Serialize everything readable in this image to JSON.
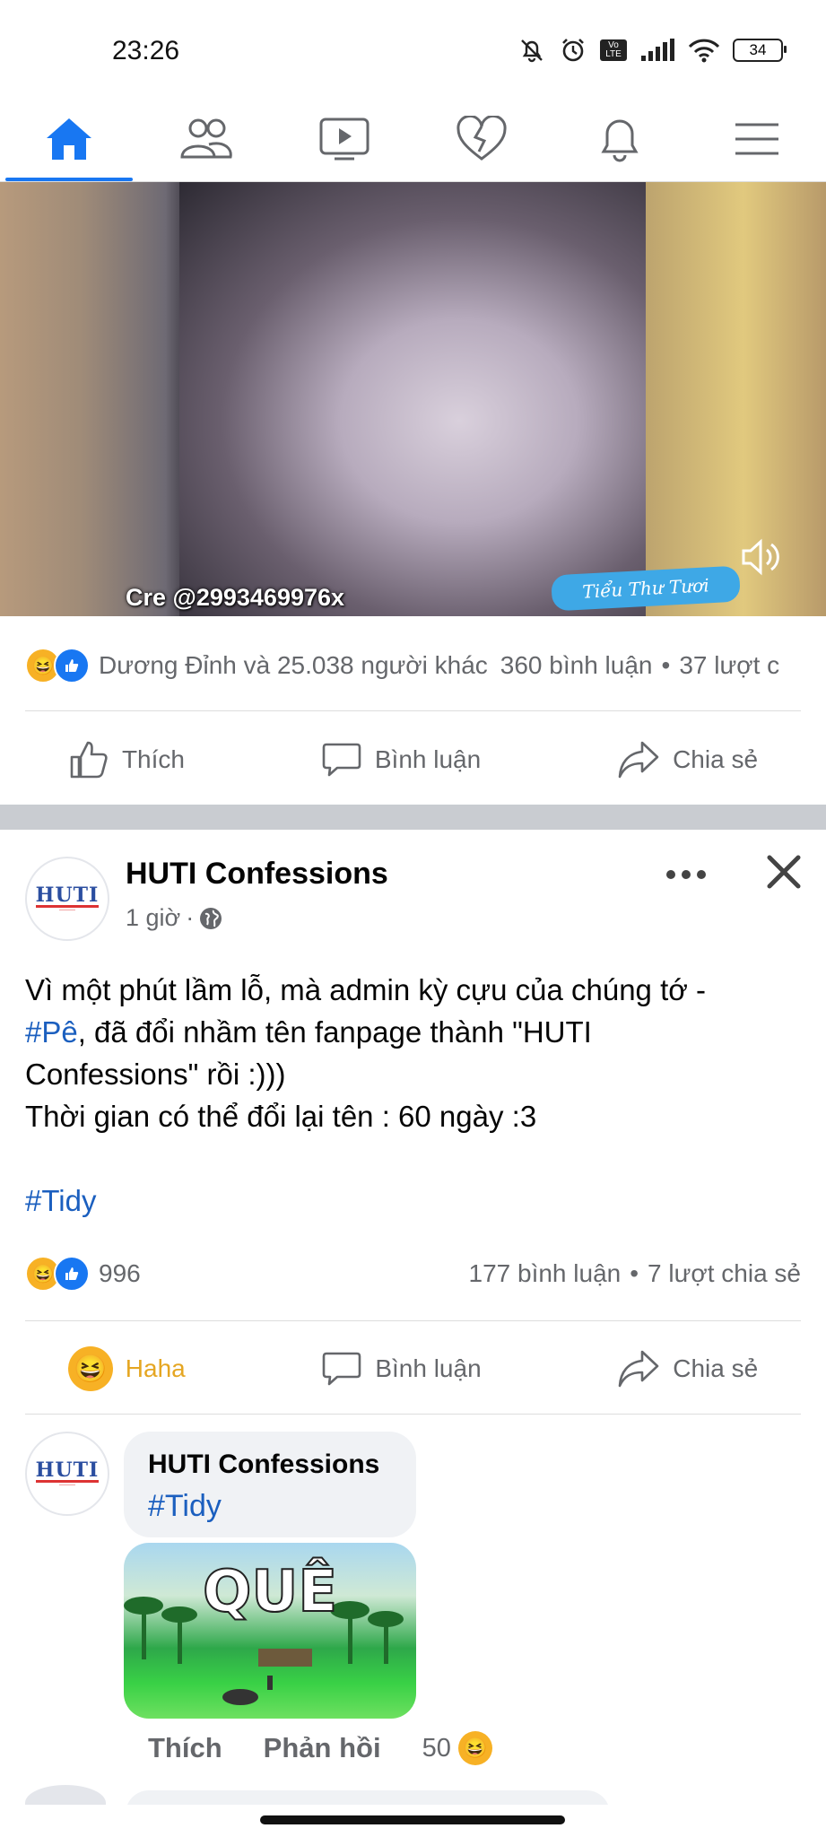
{
  "status_bar": {
    "time": "23:26",
    "battery": "34",
    "network_badge": "Vo LTE"
  },
  "nav": {
    "items": [
      "home-icon",
      "friends-icon",
      "video-icon",
      "dating-icon",
      "notifications-icon",
      "menu-icon"
    ],
    "active": "home",
    "accent": "#1877f2"
  },
  "video_post": {
    "caption": "Cre @2993469976x",
    "watermark": "Tiểu Thư Tươi",
    "reactions_text": "Dương Đỉnh và 25.038 người khác",
    "comments": "360 bình luận",
    "shares": "37 lượt c",
    "actions": {
      "like": "Thích",
      "comment": "Bình luận",
      "share": "Chia sẻ"
    }
  },
  "post": {
    "page_name": "HUTI Confessions",
    "time": "1 giờ",
    "avatar_text": "HUTI",
    "body_line1": "Vì một phút lầm lỗ, mà admin kỳ cựu của chúng tớ -",
    "body_tag": "#Pê",
    "body_line2_rest": ", đã đổi nhầm tên fanpage thành \"HUTI",
    "body_line3": "Confessions\" rồi :)))",
    "body_line4": "Thời gian có thể đổi lại tên : 60 ngày :3",
    "hashtag": "#Tidy",
    "reaction_count": "996",
    "comments": "177 bình luận",
    "shares": "7 lượt chia sẻ",
    "actions": {
      "reaction": "Haha",
      "comment": "Bình luận",
      "share": "Chia sẻ"
    },
    "haha_color": "#e5a622"
  },
  "comment": {
    "author": "HUTI Confessions",
    "text": "#Tidy",
    "image_text": "QUÊ",
    "like": "Thích",
    "reply": "Phản hồi",
    "reaction_count": "50"
  }
}
